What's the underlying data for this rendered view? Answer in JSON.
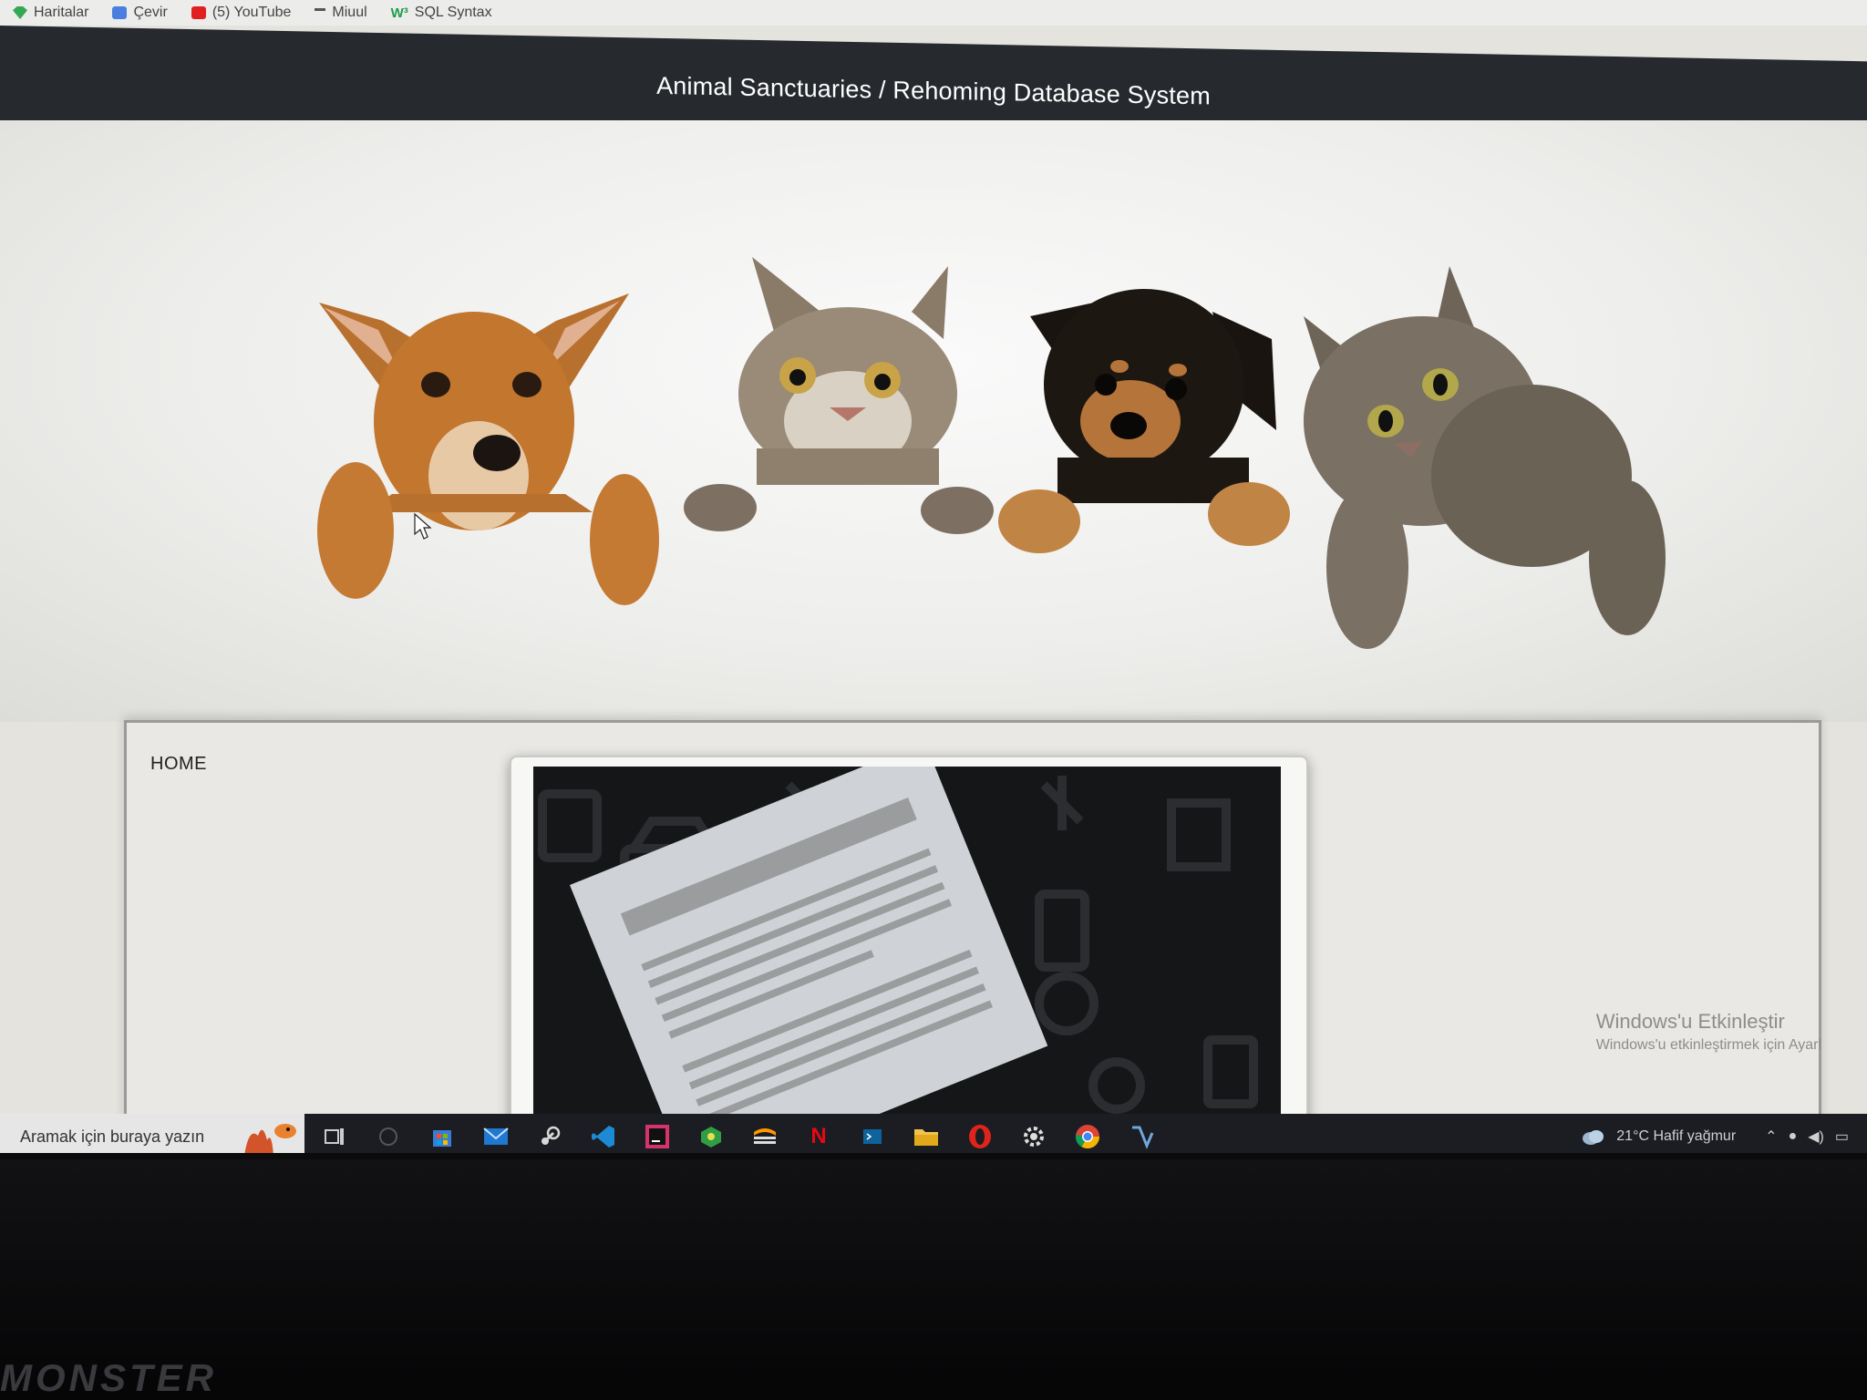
{
  "bookmarks": [
    {
      "label": "Haritalar",
      "icon": "maps-icon",
      "color": "#34a853"
    },
    {
      "label": "Çevir",
      "icon": "translate-icon",
      "color": "#4a7fe0"
    },
    {
      "label": "(5) YouTube",
      "icon": "youtube-icon",
      "color": "#e02020"
    },
    {
      "label": "Miuul",
      "icon": "miuul-icon",
      "color": "#555555"
    },
    {
      "label": "SQL Syntax",
      "icon": "w3schools-icon",
      "color": "#1f9d4a"
    }
  ],
  "header": {
    "title": "Animal Sanctuaries / Rehoming Database System"
  },
  "hero": {
    "animals": [
      {
        "name": "dog-tan-image"
      },
      {
        "name": "cat-tabby-image"
      },
      {
        "name": "puppy-rottweiler-image"
      },
      {
        "name": "cat-longhair-image"
      }
    ]
  },
  "nav": {
    "home_label": "HOME"
  },
  "watermark": {
    "line1": "Windows'u Etkinleştir",
    "line2": "Windows'u etkinleştirmek için Ayarl"
  },
  "taskbar": {
    "search_placeholder": "Aramak için buraya yazın",
    "weather": "21°C  Hafif yağmur",
    "apps": [
      {
        "name": "task-view-icon"
      },
      {
        "name": "cortana-icon"
      },
      {
        "name": "store-icon"
      },
      {
        "name": "mail-icon"
      },
      {
        "name": "steam-icon"
      },
      {
        "name": "vscode-icon"
      },
      {
        "name": "intellij-icon"
      },
      {
        "name": "app-green-icon"
      },
      {
        "name": "sublime-icon"
      },
      {
        "name": "netflix-icon"
      },
      {
        "name": "terminal-icon"
      },
      {
        "name": "file-explorer-icon"
      },
      {
        "name": "opera-icon"
      },
      {
        "name": "settings-icon"
      },
      {
        "name": "chrome-icon"
      },
      {
        "name": "python-ide-icon"
      }
    ]
  },
  "laptop": {
    "brand": "MONSTER"
  },
  "colors": {
    "header_bg": "#26292e",
    "panel_bg": "#e9e8e4",
    "taskbar_bg": "#1b1d22"
  }
}
